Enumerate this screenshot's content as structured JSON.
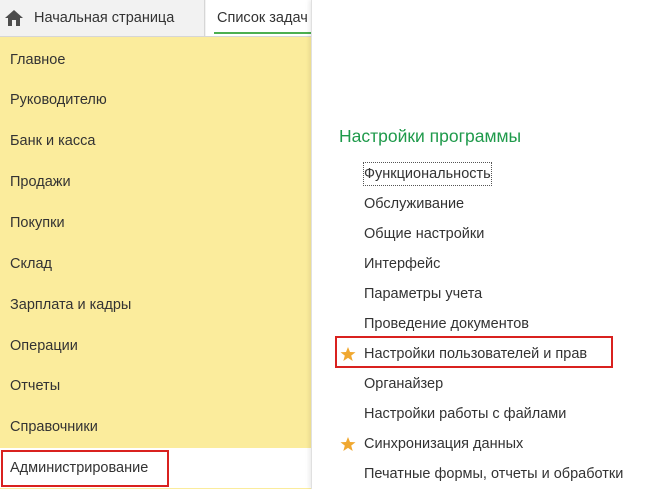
{
  "tabs": {
    "home_label": "Начальная страница",
    "tasks_label": "Список задач"
  },
  "sidebar": {
    "items": [
      {
        "label": "Главное"
      },
      {
        "label": "Руководителю"
      },
      {
        "label": "Банк и касса"
      },
      {
        "label": "Продажи"
      },
      {
        "label": "Покупки"
      },
      {
        "label": "Склад"
      },
      {
        "label": "Зарплата и кадры"
      },
      {
        "label": "Операции"
      },
      {
        "label": "Отчеты"
      },
      {
        "label": "Справочники"
      },
      {
        "label": "Администрирование"
      }
    ],
    "active": "Администрирование"
  },
  "settings": {
    "title": "Настройки программы",
    "links": [
      {
        "label": "Функциональность",
        "starred": false
      },
      {
        "label": "Обслуживание",
        "starred": false
      },
      {
        "label": "Общие настройки",
        "starred": false
      },
      {
        "label": "Интерфейс",
        "starred": false
      },
      {
        "label": "Параметры учета",
        "starred": false
      },
      {
        "label": "Проведение документов",
        "starred": false
      },
      {
        "label": "Настройки пользователей и прав",
        "starred": true
      },
      {
        "label": "Органайзер",
        "starred": false
      },
      {
        "label": "Настройки работы с файлами",
        "starred": false
      },
      {
        "label": "Синхронизация данных",
        "starred": true
      },
      {
        "label": "Печатные формы, отчеты и обработки",
        "starred": false
      }
    ]
  },
  "colors": {
    "sidebar_bg": "#fbec9c",
    "group_title": "#1f9a4b",
    "highlight_border": "#d9211f",
    "star": "#f0a830",
    "active_tab_underline": "#4caf50"
  }
}
